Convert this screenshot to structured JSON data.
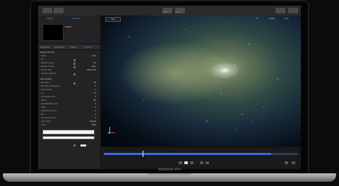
{
  "window": {
    "toolbar_left": "Library",
    "toolbar_right": "Inspector",
    "toolbar_hud_labels": [
      "Share",
      "HUD"
    ]
  },
  "browser": {
    "tabs": [
      "Library",
      "Inspector"
    ],
    "project_name": "Project"
  },
  "inspector": {
    "tabs": [
      "Properties",
      "Behaviors",
      "Filters",
      "Emitter"
    ],
    "active_tab": "Emitter",
    "section_1": "Emitter Controls",
    "rows_1": [
      {
        "label": "Shape",
        "value": "Point"
      },
      {
        "label": "3D",
        "value": ""
      },
      {
        "label": "Emission Angle",
        "value": "0.0"
      },
      {
        "label": "Emission Range",
        "value": "360.0"
      },
      {
        "label": "Render Order",
        "value": "Oldest First"
      },
      {
        "label": "Interleave Particles",
        "value": ""
      }
    ],
    "section_2": "Cell Controls",
    "rows_2": [
      {
        "label": "Birth Rate",
        "value": "30"
      },
      {
        "label": "Birth Rate Randomness",
        "value": "0"
      },
      {
        "label": "Initial Number",
        "value": "0"
      },
      {
        "label": "Life",
        "value": "5.0"
      },
      {
        "label": "Life Randomness",
        "value": "0"
      },
      {
        "label": "Speed",
        "value": "100"
      },
      {
        "label": "Speed Randomness",
        "value": "0"
      },
      {
        "label": "Angle",
        "value": "0"
      },
      {
        "label": "Angle Randomness",
        "value": "0"
      },
      {
        "label": "Spin",
        "value": "0"
      },
      {
        "label": "Spin Randomness",
        "value": "0"
      },
      {
        "label": "Color Mode",
        "value": "Original"
      },
      {
        "label": "Scale",
        "value": "100%"
      }
    ]
  },
  "canvas": {
    "view_menu": "View",
    "zoom": "Fit",
    "render": "Render",
    "view": "View"
  },
  "timeline": {
    "progress": 0.86,
    "playhead": 0.2
  },
  "device": {
    "brand": "MacBook Pro"
  },
  "colors": {
    "accent": "#3a9cff",
    "timeline_fill": "#3b6bd6"
  }
}
